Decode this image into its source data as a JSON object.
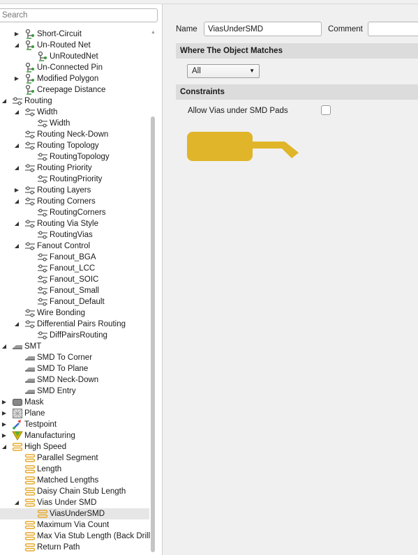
{
  "search": {
    "placeholder": "Search"
  },
  "colors": {
    "accent_gold": "#E0B52A",
    "section_bg": "#DCDCDC",
    "panel_bg": "#F0F0F0",
    "high_speed_icon": "#E6A92B",
    "testpoint_icon_blue": "#2E6FD6",
    "manufacturing_icon": "#D4B700"
  },
  "tree": [
    {
      "label": "Short-Circuit",
      "level": 1,
      "expander": "collapsed",
      "icon": "net-rule-icon"
    },
    {
      "label": "Un-Routed Net",
      "level": 1,
      "expander": "expanded",
      "icon": "net-rule-icon"
    },
    {
      "label": "UnRoutedNet",
      "level": 2,
      "expander": "none",
      "icon": "net-rule-icon"
    },
    {
      "label": "Un-Connected Pin",
      "level": 1,
      "expander": "none",
      "icon": "net-rule-icon"
    },
    {
      "label": "Modified Polygon",
      "level": 1,
      "expander": "collapsed",
      "icon": "net-rule-icon"
    },
    {
      "label": "Creepage Distance",
      "level": 1,
      "expander": "none",
      "icon": "net-rule-icon"
    },
    {
      "label": "Routing",
      "level": 0,
      "expander": "expanded",
      "icon": "routing-icon"
    },
    {
      "label": "Width",
      "level": 1,
      "expander": "expanded",
      "icon": "routing-icon"
    },
    {
      "label": "Width",
      "level": 2,
      "expander": "none",
      "icon": "routing-icon"
    },
    {
      "label": "Routing Neck-Down",
      "level": 1,
      "expander": "none",
      "icon": "routing-icon"
    },
    {
      "label": "Routing Topology",
      "level": 1,
      "expander": "expanded",
      "icon": "routing-icon"
    },
    {
      "label": "RoutingTopology",
      "level": 2,
      "expander": "none",
      "icon": "routing-icon"
    },
    {
      "label": "Routing Priority",
      "level": 1,
      "expander": "expanded",
      "icon": "routing-icon"
    },
    {
      "label": "RoutingPriority",
      "level": 2,
      "expander": "none",
      "icon": "routing-icon"
    },
    {
      "label": "Routing Layers",
      "level": 1,
      "expander": "collapsed",
      "icon": "routing-icon"
    },
    {
      "label": "Routing Corners",
      "level": 1,
      "expander": "expanded",
      "icon": "routing-icon"
    },
    {
      "label": "RoutingCorners",
      "level": 2,
      "expander": "none",
      "icon": "routing-icon"
    },
    {
      "label": "Routing Via Style",
      "level": 1,
      "expander": "expanded",
      "icon": "routing-icon"
    },
    {
      "label": "RoutingVias",
      "level": 2,
      "expander": "none",
      "icon": "routing-icon"
    },
    {
      "label": "Fanout Control",
      "level": 1,
      "expander": "expanded",
      "icon": "routing-icon"
    },
    {
      "label": "Fanout_BGA",
      "level": 2,
      "expander": "none",
      "icon": "routing-icon"
    },
    {
      "label": "Fanout_LCC",
      "level": 2,
      "expander": "none",
      "icon": "routing-icon"
    },
    {
      "label": "Fanout_SOIC",
      "level": 2,
      "expander": "none",
      "icon": "routing-icon"
    },
    {
      "label": "Fanout_Small",
      "level": 2,
      "expander": "none",
      "icon": "routing-icon"
    },
    {
      "label": "Fanout_Default",
      "level": 2,
      "expander": "none",
      "icon": "routing-icon"
    },
    {
      "label": "Wire Bonding",
      "level": 1,
      "expander": "none",
      "icon": "routing-icon"
    },
    {
      "label": "Differential Pairs Routing",
      "level": 1,
      "expander": "expanded",
      "icon": "routing-icon"
    },
    {
      "label": "DiffPairsRouting",
      "level": 2,
      "expander": "none",
      "icon": "routing-icon"
    },
    {
      "label": "SMT",
      "level": 0,
      "expander": "expanded",
      "icon": "smt-icon"
    },
    {
      "label": "SMD To Corner",
      "level": 1,
      "expander": "none",
      "icon": "smt-icon"
    },
    {
      "label": "SMD To Plane",
      "level": 1,
      "expander": "none",
      "icon": "smt-icon"
    },
    {
      "label": "SMD Neck-Down",
      "level": 1,
      "expander": "none",
      "icon": "smt-icon"
    },
    {
      "label": "SMD Entry",
      "level": 1,
      "expander": "none",
      "icon": "smt-icon"
    },
    {
      "label": "Mask",
      "level": 0,
      "expander": "collapsed",
      "icon": "mask-icon"
    },
    {
      "label": "Plane",
      "level": 0,
      "expander": "collapsed",
      "icon": "plane-icon"
    },
    {
      "label": "Testpoint",
      "level": 0,
      "expander": "collapsed",
      "icon": "testpoint-icon"
    },
    {
      "label": "Manufacturing",
      "level": 0,
      "expander": "collapsed",
      "icon": "manufacturing-icon"
    },
    {
      "label": "High Speed",
      "level": 0,
      "expander": "expanded",
      "icon": "high-speed-icon"
    },
    {
      "label": "Parallel Segment",
      "level": 1,
      "expander": "none",
      "icon": "high-speed-icon"
    },
    {
      "label": "Length",
      "level": 1,
      "expander": "none",
      "icon": "high-speed-icon"
    },
    {
      "label": "Matched Lengths",
      "level": 1,
      "expander": "none",
      "icon": "high-speed-icon"
    },
    {
      "label": "Daisy Chain Stub Length",
      "level": 1,
      "expander": "none",
      "icon": "high-speed-icon"
    },
    {
      "label": "Vias Under SMD",
      "level": 1,
      "expander": "expanded",
      "icon": "high-speed-icon"
    },
    {
      "label": "ViasUnderSMD",
      "level": 2,
      "expander": "none",
      "icon": "high-speed-icon",
      "selected": true
    },
    {
      "label": "Maximum Via Count",
      "level": 1,
      "expander": "none",
      "icon": "high-speed-icon"
    },
    {
      "label": "Max Via Stub Length (Back Drill",
      "level": 1,
      "expander": "none",
      "icon": "high-speed-icon"
    },
    {
      "label": "Return Path",
      "level": 1,
      "expander": "none",
      "icon": "high-speed-icon"
    }
  ],
  "properties": {
    "name_label": "Name",
    "name_value": "ViasUnderSMD",
    "comment_label": "Comment",
    "comment_value": "",
    "where_header": "Where The Object Matches",
    "scope_selected": "All",
    "constraints_header": "Constraints",
    "constraint_label": "Allow Vias under SMD Pads",
    "constraint_checked": false
  }
}
